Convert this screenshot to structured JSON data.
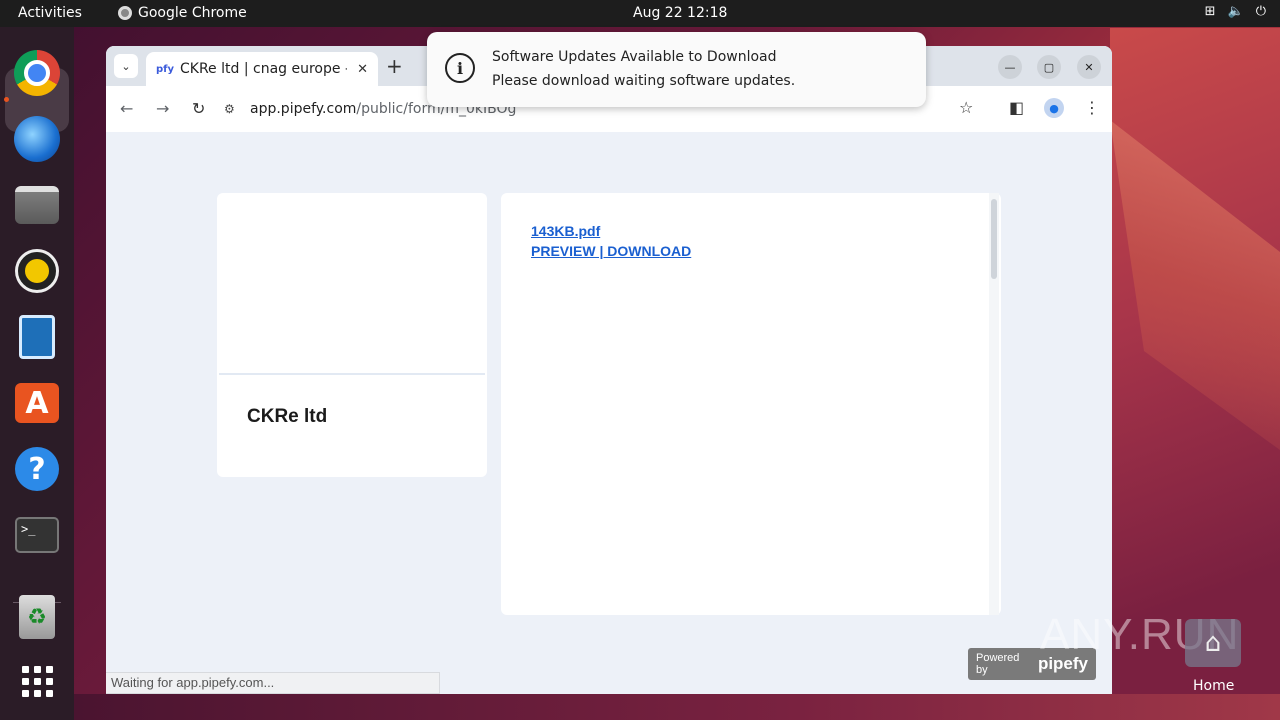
{
  "topbar": {
    "activities": "Activities",
    "app_name": "Google Chrome",
    "clock": "Aug 22  12:18",
    "tray": [
      "network-icon",
      "volume-icon",
      "power-icon"
    ]
  },
  "dock": {
    "items": [
      "chrome-icon",
      "thunderbird-icon",
      "files-icon",
      "rhythmbox-icon",
      "writer-icon",
      "app-center-icon",
      "help-icon",
      "terminal-icon",
      "trash-icon",
      "app-grid-icon"
    ],
    "terminal_text": ">_",
    "store_text": "A",
    "help_text": "?",
    "trash_text": "♻"
  },
  "browser": {
    "tab_favicon": "pfy",
    "tab_title": "CKRe ltd | cnag europe - I",
    "url_domain": "app.pipefy.com",
    "url_path": "/public/form/m_0kIBOg"
  },
  "page": {
    "org_name": "CKRe ltd",
    "file_link": "143KB.pdf",
    "preview_download": "PREVIEW | DOWNLOAD",
    "powered_by": "Powered by",
    "brand": "pipefy",
    "status": "Waiting for app.pipefy.com..."
  },
  "notification": {
    "title": "Software Updates Available to Download",
    "body": "Please download waiting software updates."
  },
  "desktop": {
    "watermark": "ANY.RUN",
    "home_label": "Home"
  },
  "colors": {
    "link": "#1a5fd0",
    "accent": "#e95420"
  }
}
